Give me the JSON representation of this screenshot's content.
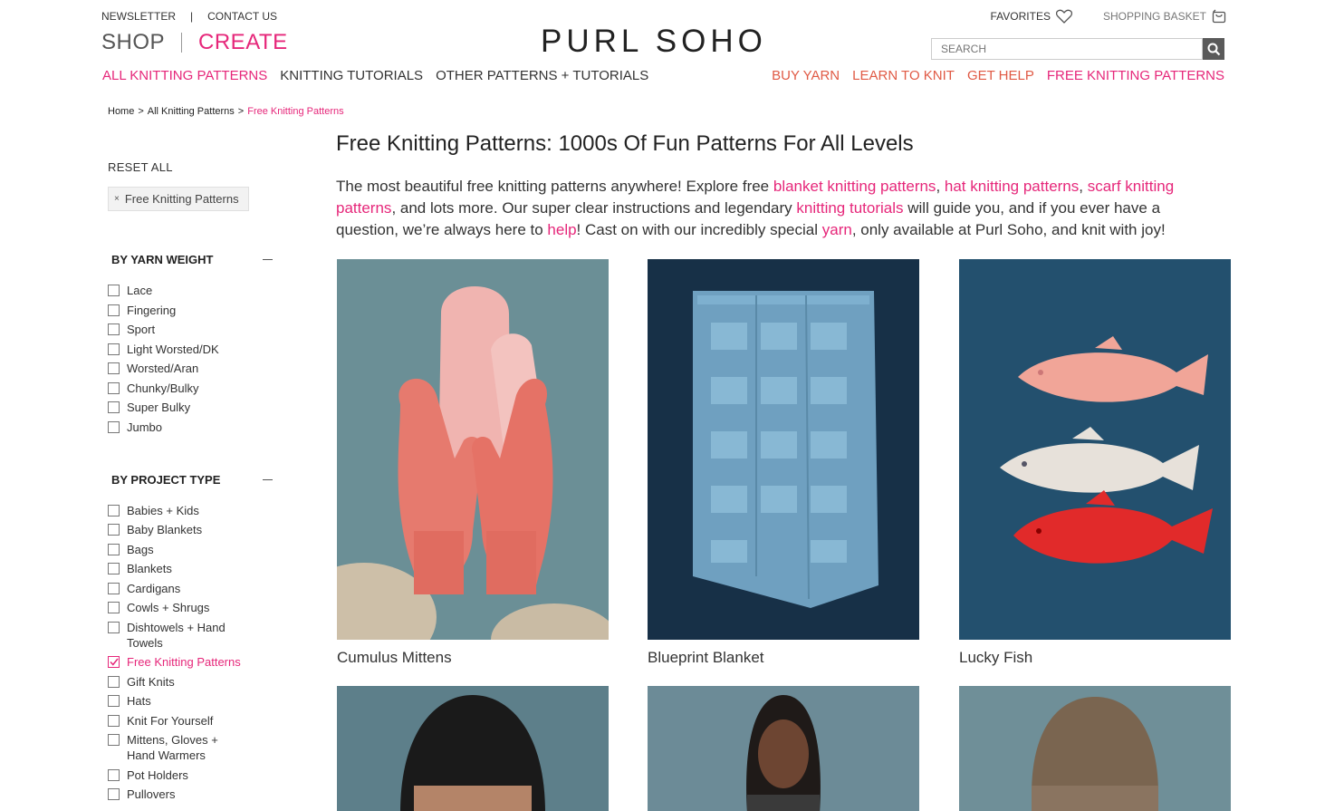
{
  "utility": {
    "newsletter": "NEWSLETTER",
    "separator": "|",
    "contact": "CONTACT US",
    "favorites": "FAVORITES",
    "basket": "SHOPPING BASKET"
  },
  "brand": {
    "shop": "SHOP",
    "create": "CREATE",
    "logo": "PURL SOHO"
  },
  "search": {
    "placeholder": "SEARCH"
  },
  "nav_left": [
    {
      "label": "ALL KNITTING PATTERNS",
      "active": true
    },
    {
      "label": "KNITTING TUTORIALS"
    },
    {
      "label": "OTHER PATTERNS + TUTORIALS"
    }
  ],
  "nav_right": [
    {
      "label": "BUY YARN"
    },
    {
      "label": "LEARN TO KNIT"
    },
    {
      "label": "GET HELP"
    },
    {
      "label": "FREE KNITTING PATTERNS"
    }
  ],
  "breadcrumb": {
    "home": "Home",
    "sep": ">",
    "all": "All Knitting Patterns",
    "current": "Free Knitting Patterns"
  },
  "sidebar": {
    "reset": "RESET ALL",
    "chip_x": "×",
    "chip_label": "Free Knitting Patterns",
    "yarn_weight": {
      "title": "BY YARN WEIGHT",
      "items": [
        "Lace",
        "Fingering",
        "Sport",
        "Light Worsted/DK",
        "Worsted/Aran",
        "Chunky/Bulky",
        "Super Bulky",
        "Jumbo"
      ]
    },
    "project_type": {
      "title": "BY PROJECT TYPE",
      "items": [
        "Babies + Kids",
        "Baby Blankets",
        "Bags",
        "Blankets",
        "Cardigans",
        "Cowls + Shrugs",
        "Dishtowels + Hand Towels",
        "Free Knitting Patterns",
        "Gift Knits",
        "Hats",
        "Knit For Yourself",
        "Mittens, Gloves + Hand Warmers",
        "Pot Holders",
        "Pullovers"
      ],
      "checked": "Free Knitting Patterns"
    }
  },
  "main": {
    "title": "Free Knitting Patterns: 1000s Of Fun Patterns For All Levels",
    "intro": {
      "t1": "The most beautiful free knitting patterns anywhere! Explore free ",
      "l1": "blanket knitting patterns",
      "t2": ", ",
      "l2": "hat knitting patterns",
      "t3": ", ",
      "l3": "scarf knitting patterns",
      "t4": ", and lots more. Our super clear instructions and legendary ",
      "l4": "knitting tutorials",
      "t5": " will guide you, and if you ever have a question, we’re always here to ",
      "l5": "help",
      "t6": "! Cast on with our incredibly special ",
      "l6": "yarn",
      "t7": ", only available at Purl Soho, and knit with joy!"
    },
    "products": [
      {
        "name": "Cumulus Mittens"
      },
      {
        "name": "Blueprint Blanket"
      },
      {
        "name": "Lucky Fish"
      }
    ]
  },
  "colors": {
    "accent_pink": "#e6277a",
    "accent_orange": "#e05a45"
  }
}
